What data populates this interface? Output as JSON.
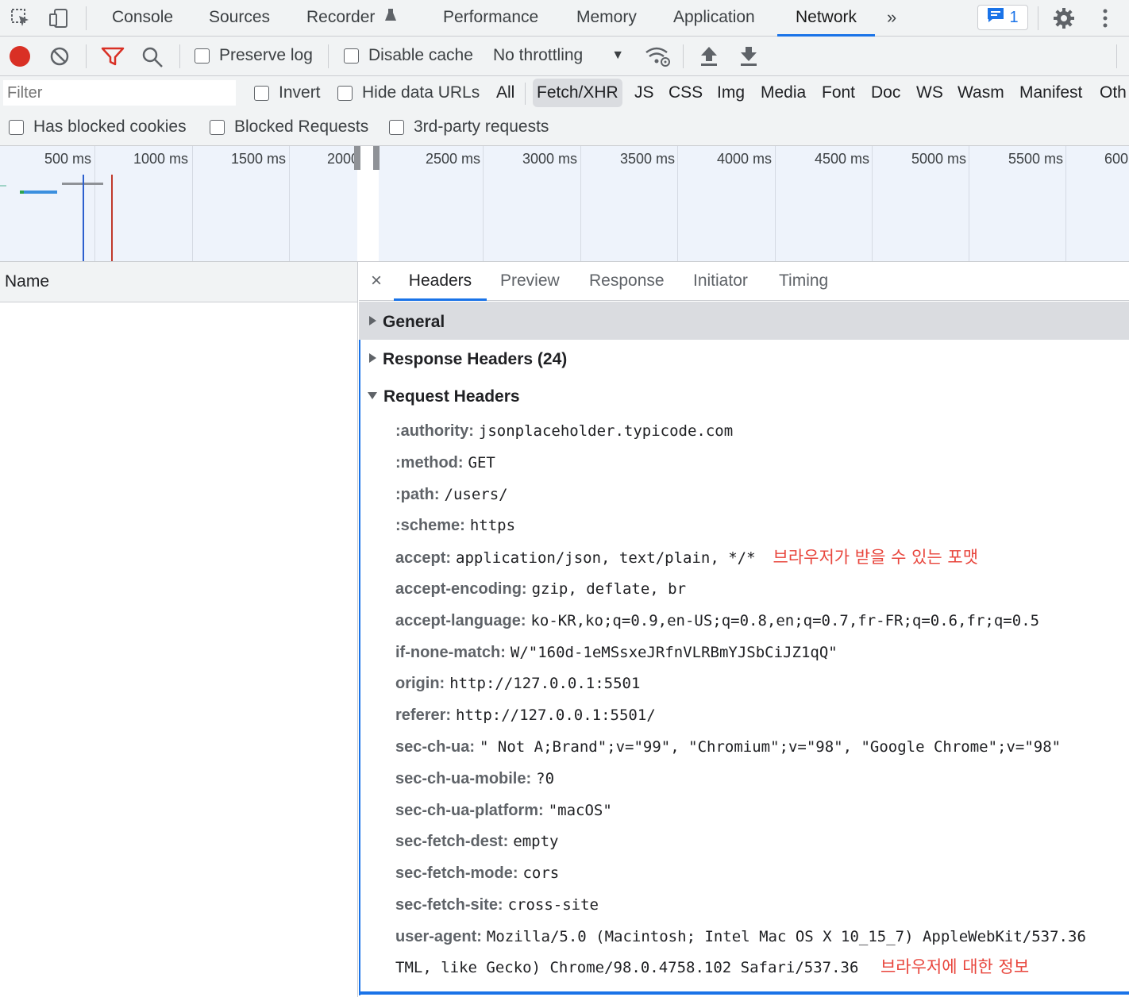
{
  "tabs": [
    "Console",
    "Sources",
    "Recorder",
    "Performance",
    "Memory",
    "Application",
    "Network"
  ],
  "active_tab": "Network",
  "issues_badge_count": "1",
  "toolbar": {
    "preserve_log": "Preserve log",
    "disable_cache": "Disable cache",
    "throttling": "No throttling"
  },
  "filter": {
    "placeholder": "Filter",
    "invert": "Invert",
    "hide_data_urls": "Hide data URLs",
    "types": [
      "All",
      "Fetch/XHR",
      "JS",
      "CSS",
      "Img",
      "Media",
      "Font",
      "Doc",
      "WS",
      "Wasm",
      "Manifest",
      "Oth"
    ],
    "active_type": "Fetch/XHR",
    "has_blocked_cookies": "Has blocked cookies",
    "blocked_requests": "Blocked Requests",
    "third_party": "3rd-party requests"
  },
  "timeline_ticks": [
    "500 ms",
    "1000 ms",
    "1500 ms",
    "2000 ms",
    "2500 ms",
    "3000 ms",
    "3500 ms",
    "4000 ms",
    "4500 ms",
    "5000 ms",
    "5500 ms",
    "600"
  ],
  "request_list": {
    "name_header": "Name"
  },
  "detail_tabs": [
    "Headers",
    "Preview",
    "Response",
    "Initiator",
    "Timing"
  ],
  "active_detail_tab": "Headers",
  "sections": {
    "general": "General",
    "response_headers": "Response Headers (24)",
    "request_headers": "Request Headers"
  },
  "request_headers": [
    {
      "name": ":authority:",
      "value": "jsonplaceholder.typicode.com"
    },
    {
      "name": ":method:",
      "value": "GET"
    },
    {
      "name": ":path:",
      "value": "/users/"
    },
    {
      "name": ":scheme:",
      "value": "https"
    },
    {
      "name": "accept:",
      "value": "application/json, text/plain, */*",
      "note": "브라우저가 받을 수 있는 포맷"
    },
    {
      "name": "accept-encoding:",
      "value": "gzip, deflate, br"
    },
    {
      "name": "accept-language:",
      "value": "ko-KR,ko;q=0.9,en-US;q=0.8,en;q=0.7,fr-FR;q=0.6,fr;q=0.5"
    },
    {
      "name": "if-none-match:",
      "value": "W/\"160d-1eMSsxeJRfnVLRBmYJSbCiJZ1qQ\""
    },
    {
      "name": "origin:",
      "value": "http://127.0.0.1:5501"
    },
    {
      "name": "referer:",
      "value": "http://127.0.0.1:5501/"
    },
    {
      "name": "sec-ch-ua:",
      "value": "\" Not A;Brand\";v=\"99\", \"Chromium\";v=\"98\", \"Google Chrome\";v=\"98\""
    },
    {
      "name": "sec-ch-ua-mobile:",
      "value": "?0"
    },
    {
      "name": "sec-ch-ua-platform:",
      "value": "\"macOS\""
    },
    {
      "name": "sec-fetch-dest:",
      "value": "empty"
    },
    {
      "name": "sec-fetch-mode:",
      "value": "cors"
    },
    {
      "name": "sec-fetch-site:",
      "value": "cross-site"
    },
    {
      "name": "user-agent:",
      "value": "Mozilla/5.0 (Macintosh; Intel Mac OS X 10_15_7) AppleWebKit/537.36"
    }
  ],
  "user_agent_continuation": "TML, like Gecko) Chrome/98.0.4758.102 Safari/537.36",
  "user_agent_note": "브라우저에 대한 정보",
  "colors": {
    "accent": "#1a73e8",
    "record": "#d93025",
    "note": "#e8453c"
  }
}
